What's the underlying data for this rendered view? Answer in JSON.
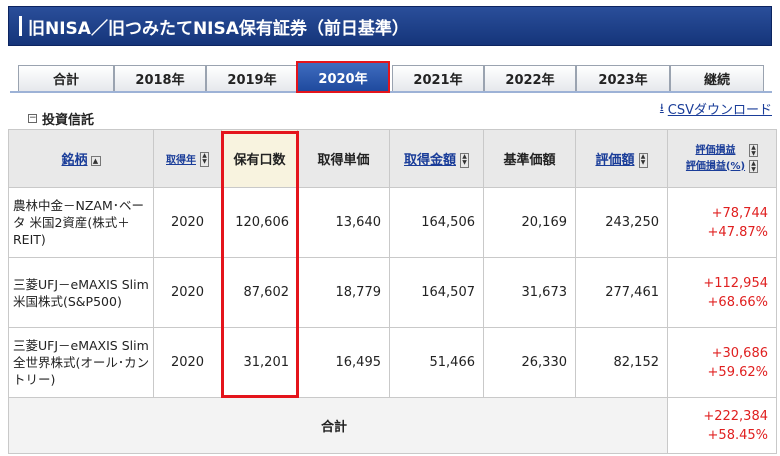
{
  "header": {
    "title": "旧NISA／旧つみたてNISA保有証券（前日基準）"
  },
  "tabs": [
    {
      "label": "合計",
      "active": false
    },
    {
      "label": "2018年",
      "active": false
    },
    {
      "label": "2019年",
      "active": false
    },
    {
      "label": "2020年",
      "active": true
    },
    {
      "label": "2021年",
      "active": false
    },
    {
      "label": "2022年",
      "active": false
    },
    {
      "label": "2023年",
      "active": false
    },
    {
      "label": "継続",
      "active": false
    }
  ],
  "section": {
    "title": "投資信託",
    "toggle": "−"
  },
  "csv": {
    "label": "CSVダウンロード"
  },
  "columns": {
    "name": "銘柄",
    "year": "取得年",
    "units": "保有口数",
    "unit_price": "取得単価",
    "acq_amount": "取得金額",
    "base_price": "基準価額",
    "valuation": "評価額",
    "gain_line1": "評価損益",
    "gain_line2": "評価損益(%)"
  },
  "rows": [
    {
      "name": "農林中金－NZAM･ベータ 米国2資産(株式＋REIT)",
      "year": "2020",
      "units": "120,606",
      "unit_price": "13,640",
      "acq_amount": "164,506",
      "base_price": "20,169",
      "valuation": "243,250",
      "gain": "+78,744",
      "gain_pct": "+47.87%"
    },
    {
      "name": "三菱UFJ－eMAXIS Slim 米国株式(S&P500)",
      "year": "2020",
      "units": "87,602",
      "unit_price": "18,779",
      "acq_amount": "164,507",
      "base_price": "31,673",
      "valuation": "277,461",
      "gain": "+112,954",
      "gain_pct": "+68.66%"
    },
    {
      "name": "三菱UFJ－eMAXIS Slim 全世界株式(オール･カントリー)",
      "year": "2020",
      "units": "31,201",
      "unit_price": "16,495",
      "acq_amount": "51,466",
      "base_price": "26,330",
      "valuation": "82,152",
      "gain": "+30,686",
      "gain_pct": "+59.62%"
    }
  ],
  "total": {
    "label": "合計",
    "gain": "+222,384",
    "gain_pct": "+58.45%"
  },
  "colors": {
    "header_bg": "#1f4488",
    "active_tab": "#2b5cb3",
    "highlight_border": "#e4141b",
    "gain_text": "#e02020"
  }
}
